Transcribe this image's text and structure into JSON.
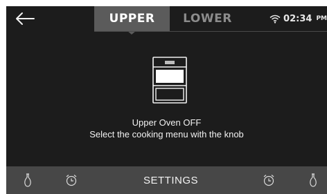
{
  "colors": {
    "background": "#1c1c1c",
    "active_tab": "#5b5b5b",
    "inactive_tab_text": "#8c8c8c",
    "bottom_bar": "#474747",
    "text": "#f2f2f2"
  },
  "header": {
    "back_icon": "arrow-left-icon",
    "tabs": [
      {
        "label": "UPPER",
        "active": true
      },
      {
        "label": "LOWER",
        "active": false
      }
    ],
    "status": {
      "wifi_icon": "wifi-icon",
      "time": "02:34",
      "ampm": "PM"
    }
  },
  "main": {
    "oven_icon": "oven-icon",
    "line1": "Upper Oven OFF",
    "line2": "Select the cooking menu with the knob"
  },
  "footer": {
    "left_icons": [
      "probe-icon",
      "timer-icon"
    ],
    "settings_label": "SETTINGS",
    "right_icons": [
      "timer-icon",
      "probe-icon"
    ]
  }
}
